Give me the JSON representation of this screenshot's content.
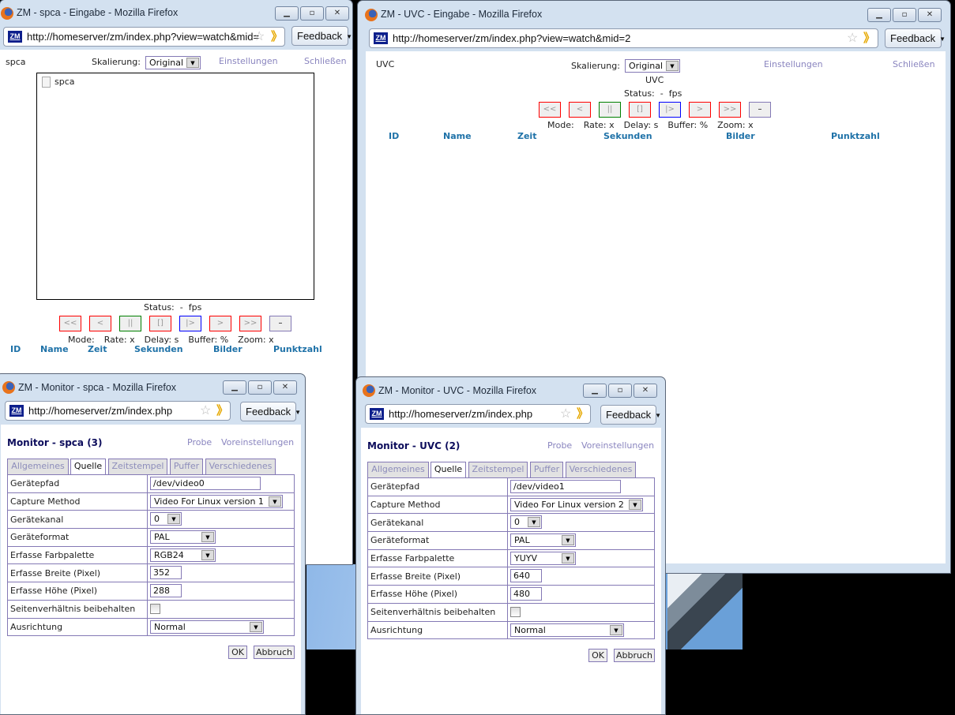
{
  "watch_spca": {
    "window_title": "ZM - spca - Eingabe - Mozilla Firefox",
    "url": "http://homeserver/zm/index.php?view=watch&mid=",
    "feedback": "Feedback",
    "monitor_name": "spca",
    "scale_label": "Skalierung:",
    "scale_value": "Original",
    "settings_link": "Einstellungen",
    "close_link": "Schließen",
    "image_alt": "spca",
    "status": "Status:  -  fps",
    "controls": [
      {
        "label": "<<",
        "color": "#ff0000"
      },
      {
        "label": "<",
        "color": "#ff0000"
      },
      {
        "label": "||",
        "color": "#008000"
      },
      {
        "label": "[]",
        "color": "#ff0000"
      },
      {
        "label": "|>",
        "color": "#0000ff"
      },
      {
        "label": ">",
        "color": "#ff0000"
      },
      {
        "label": ">>",
        "color": "#ff0000"
      },
      {
        "label": "–",
        "color": "#8479b5"
      }
    ],
    "mode_line": [
      "Mode:",
      "Rate: x",
      "Delay: s",
      "Buffer: %",
      "Zoom: x"
    ],
    "columns": [
      "ID",
      "Name",
      "Zeit",
      "Sekunden",
      "Bilder",
      "Punktzahl"
    ]
  },
  "watch_uvc": {
    "window_title": "ZM - UVC - Eingabe - Mozilla Firefox",
    "url": "http://homeserver/zm/index.php?view=watch&mid=2",
    "feedback": "Feedback",
    "monitor_name": "UVC",
    "scale_label": "Skalierung:",
    "scale_value": "Original",
    "settings_link": "Einstellungen",
    "close_link": "Schließen",
    "stream_label": "UVC",
    "status": "Status:  -  fps",
    "controls": [
      {
        "label": "<<",
        "color": "#ff0000"
      },
      {
        "label": "<",
        "color": "#ff0000"
      },
      {
        "label": "||",
        "color": "#008000"
      },
      {
        "label": "[]",
        "color": "#ff0000"
      },
      {
        "label": "|>",
        "color": "#0000ff"
      },
      {
        "label": ">",
        "color": "#ff0000"
      },
      {
        "label": ">>",
        "color": "#ff0000"
      },
      {
        "label": "–",
        "color": "#8479b5"
      }
    ],
    "mode_line": [
      "Mode:",
      "Rate: x",
      "Delay: s",
      "Buffer: %",
      "Zoom: x"
    ],
    "columns": [
      "ID",
      "Name",
      "Zeit",
      "Sekunden",
      "Bilder",
      "Punktzahl"
    ]
  },
  "monitor_spca": {
    "window_title": "ZM - Monitor - spca - Mozilla Firefox",
    "url": "http://homeserver/zm/index.php",
    "feedback": "Feedback",
    "heading": "Monitor - spca (3)",
    "probe_link": "Probe",
    "presets_link": "Voreinstellungen",
    "tabs": [
      "Allgemeines",
      "Quelle",
      "Zeitstempel",
      "Puffer",
      "Verschiedenes"
    ],
    "active_tab": "Quelle",
    "fields": [
      {
        "label": "Gerätepfad",
        "type": "text",
        "value": "/dev/video0"
      },
      {
        "label": "Capture Method",
        "type": "select",
        "value": "Video For Linux version 1"
      },
      {
        "label": "Gerätekanal",
        "type": "select",
        "value": "0"
      },
      {
        "label": "Geräteformat",
        "type": "select",
        "value": "PAL"
      },
      {
        "label": "Erfasse Farbpalette",
        "type": "select",
        "value": "RGB24"
      },
      {
        "label": "Erfasse Breite (Pixel)",
        "type": "text",
        "value": "352"
      },
      {
        "label": "Erfasse Höhe (Pixel)",
        "type": "text",
        "value": "288"
      },
      {
        "label": "Seitenverhältnis beibehalten",
        "type": "checkbox",
        "value": false
      },
      {
        "label": "Ausrichtung",
        "type": "select",
        "value": "Normal"
      }
    ],
    "ok": "OK",
    "cancel": "Abbruch"
  },
  "monitor_uvc": {
    "window_title": "ZM - Monitor - UVC - Mozilla Firefox",
    "url": "http://homeserver/zm/index.php",
    "feedback": "Feedback",
    "heading": "Monitor - UVC (2)",
    "probe_link": "Probe",
    "presets_link": "Voreinstellungen",
    "tabs": [
      "Allgemeines",
      "Quelle",
      "Zeitstempel",
      "Puffer",
      "Verschiedenes"
    ],
    "active_tab": "Quelle",
    "fields": [
      {
        "label": "Gerätepfad",
        "type": "text",
        "value": "/dev/video1"
      },
      {
        "label": "Capture Method",
        "type": "select",
        "value": "Video For Linux version 2"
      },
      {
        "label": "Gerätekanal",
        "type": "select",
        "value": "0"
      },
      {
        "label": "Geräteformat",
        "type": "select",
        "value": "PAL"
      },
      {
        "label": "Erfasse Farbpalette",
        "type": "select",
        "value": "YUYV"
      },
      {
        "label": "Erfasse Breite (Pixel)",
        "type": "text",
        "value": "640"
      },
      {
        "label": "Erfasse Höhe (Pixel)",
        "type": "text",
        "value": "480"
      },
      {
        "label": "Seitenverhältnis beibehalten",
        "type": "checkbox",
        "value": false
      },
      {
        "label": "Ausrichtung",
        "type": "select",
        "value": "Normal"
      }
    ],
    "ok": "OK",
    "cancel": "Abbruch"
  }
}
